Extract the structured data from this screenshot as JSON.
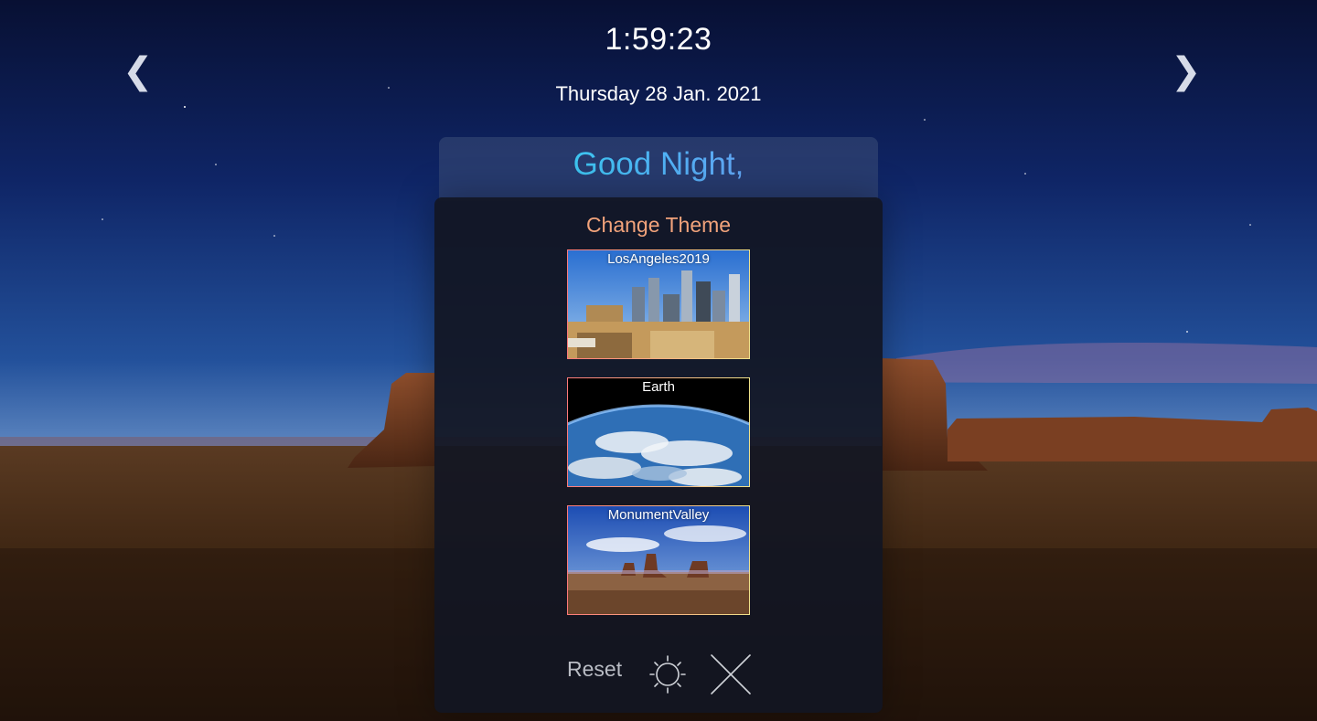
{
  "clock": {
    "time": "1:59:23"
  },
  "date": {
    "text": "Thursday 28 Jan. 2021"
  },
  "navigation": {
    "prev_glyph": "❮",
    "next_glyph": "❯",
    "prev_icon": "chevron-left-icon",
    "next_icon": "chevron-right-icon"
  },
  "greeting": {
    "text": "Good Night,"
  },
  "theme_panel": {
    "title": "Change Theme",
    "themes": [
      {
        "label": "LosAngeles2019"
      },
      {
        "label": "Earth"
      },
      {
        "label": "MonumentValley"
      }
    ],
    "reset_label": "Reset",
    "sun_icon": "sun-icon",
    "close_icon": "close-icon"
  },
  "colors": {
    "sky_top": "#0a1540",
    "greeting_gradient": [
      "#1ee0e6",
      "#7b8ef0"
    ],
    "panel_title": "#f2a37b",
    "card_border": [
      "#ff7a7a",
      "#f0e28a"
    ]
  }
}
